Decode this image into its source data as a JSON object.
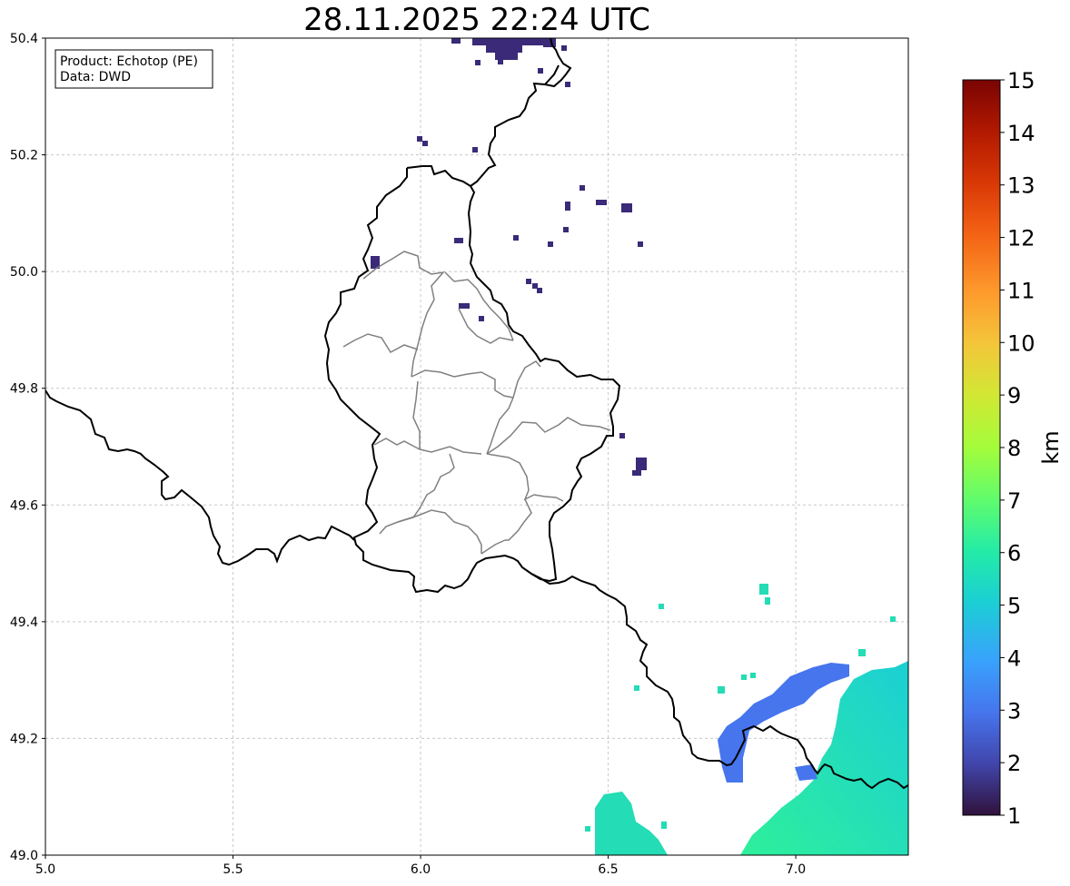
{
  "title": "28.11.2025 22:24 UTC",
  "info_box": {
    "product_line": "Product: Echotop (PE)",
    "data_line": "Data: DWD"
  },
  "map": {
    "extent": {
      "lon": [
        5.0,
        7.3
      ],
      "lat": [
        49.0,
        50.4
      ]
    },
    "grid": true,
    "x_ticks": [
      {
        "value": 5.0,
        "label": "5.0"
      },
      {
        "value": 5.5,
        "label": "5.5"
      },
      {
        "value": 6.0,
        "label": "6.0"
      },
      {
        "value": 6.5,
        "label": "6.5"
      },
      {
        "value": 7.0,
        "label": "7.0"
      }
    ],
    "y_ticks": [
      {
        "value": 49.0,
        "label": "49.0"
      },
      {
        "value": 49.2,
        "label": "49.2"
      },
      {
        "value": 49.4,
        "label": "49.4"
      },
      {
        "value": 49.6,
        "label": "49.6"
      },
      {
        "value": 49.8,
        "label": "49.8"
      },
      {
        "value": 50.0,
        "label": "50.0"
      },
      {
        "value": 50.2,
        "label": "50.2"
      },
      {
        "value": 50.4,
        "label": "50.4"
      }
    ],
    "colors": {
      "country_border": "#000000",
      "canton_border": "#808080",
      "grid": "#c8c8c8"
    }
  },
  "colorbar": {
    "unit": "km",
    "min": 1,
    "max": 15,
    "ticks": [
      "1",
      "2",
      "3",
      "4",
      "5",
      "6",
      "7",
      "8",
      "9",
      "10",
      "11",
      "12",
      "13",
      "14",
      "15"
    ],
    "colormap": "turbo",
    "stops": [
      "#30123b",
      "#4145ab",
      "#4675ed",
      "#39a2fc",
      "#1bcfd4",
      "#24eca6",
      "#61fc6c",
      "#a4fc3b",
      "#d1e834",
      "#f3c63a",
      "#fe9b2d",
      "#f36315",
      "#d93806",
      "#b11901",
      "#7a0402"
    ]
  },
  "echo_cells": [
    {
      "name": "north-cluster",
      "lon": 6.28,
      "lat": 50.37,
      "km": 1.5
    },
    {
      "name": "east-scatter",
      "lon": 6.55,
      "lat": 50.09,
      "km": 1.5
    },
    {
      "name": "luxembourg-east",
      "lon": 6.58,
      "lat": 49.66,
      "km": 2.0
    },
    {
      "name": "saar-band",
      "lon": 6.95,
      "lat": 49.24,
      "km": 3.0
    },
    {
      "name": "southeast-field",
      "lon": 7.15,
      "lat": 49.15,
      "km": 5.5
    },
    {
      "name": "south-field",
      "lon": 6.55,
      "lat": 49.05,
      "km": 5.5
    }
  ]
}
